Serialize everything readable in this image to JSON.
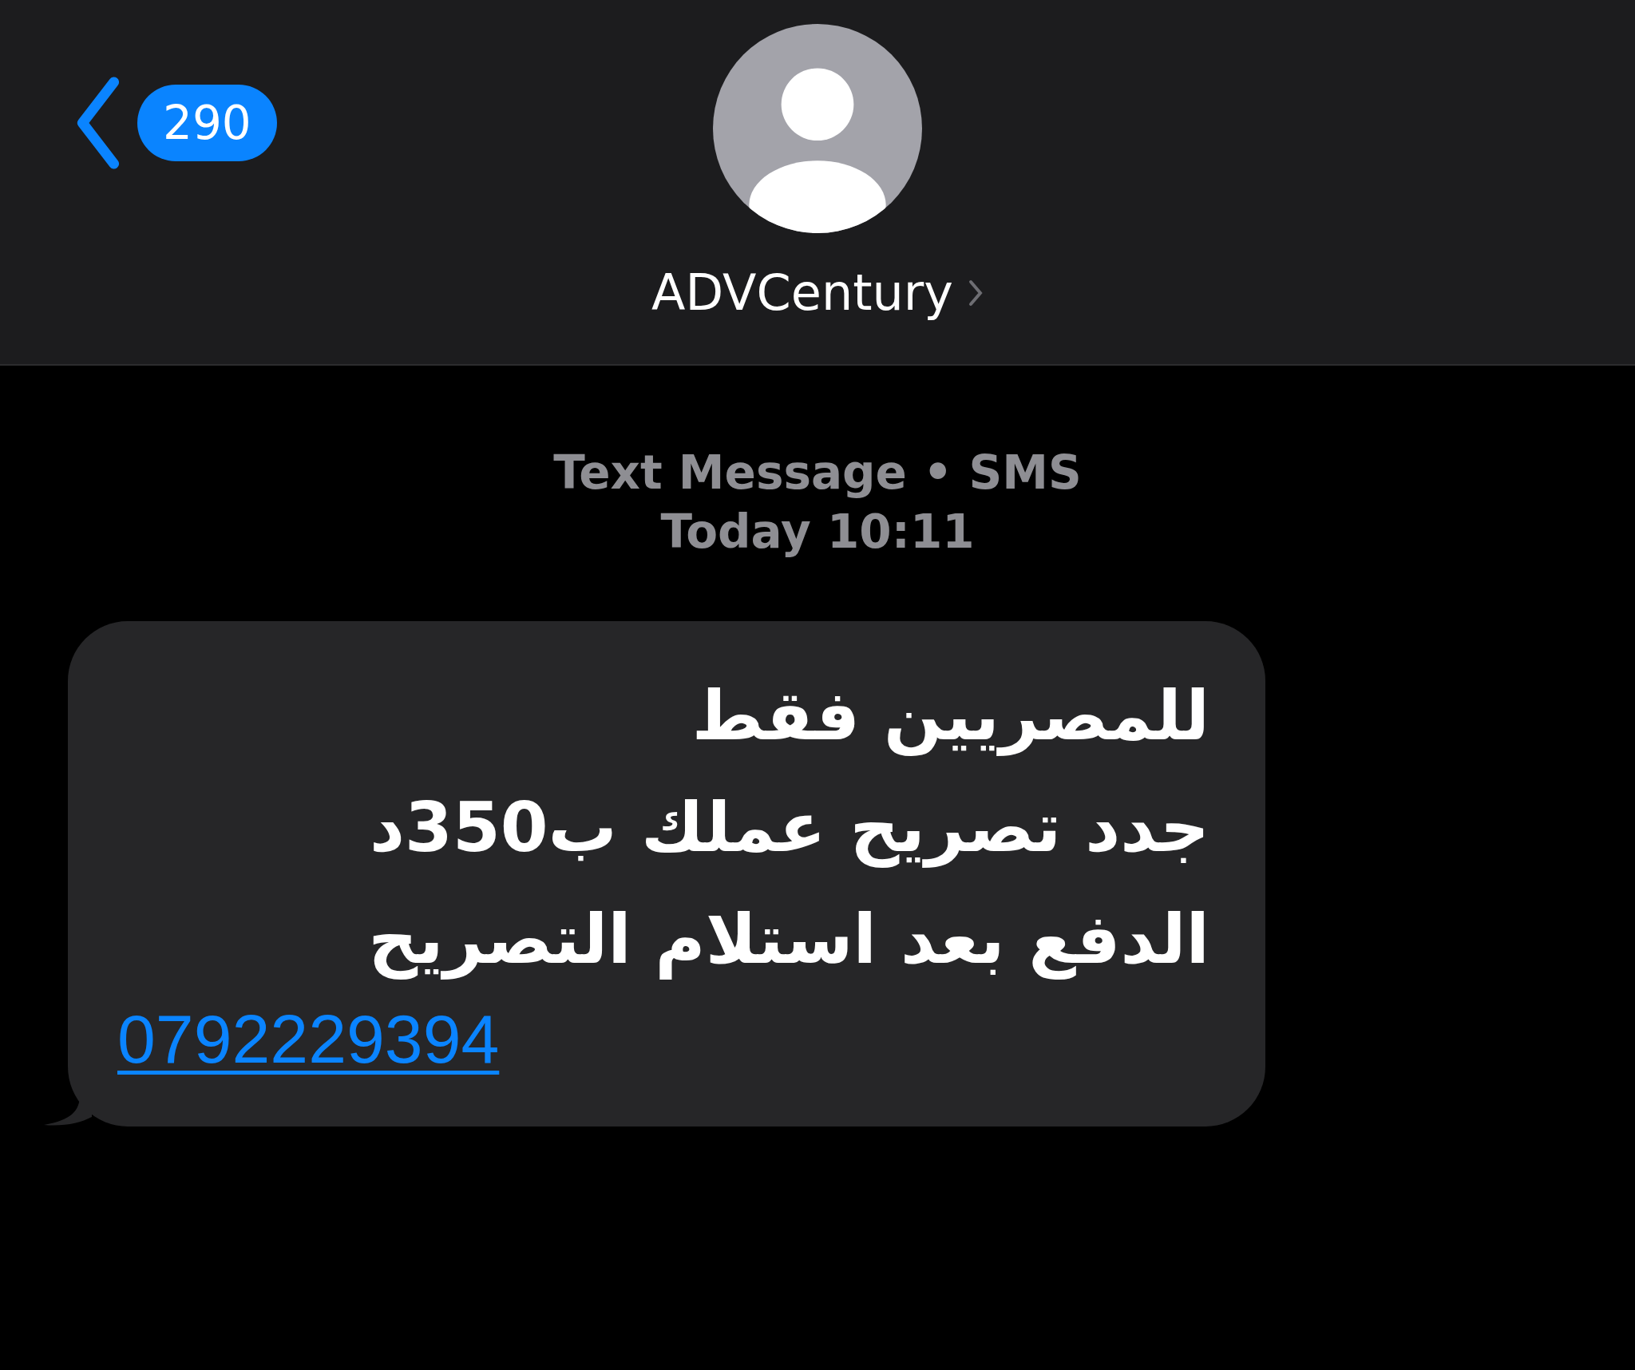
{
  "header": {
    "back_count": "290",
    "contact_name": "ADVCentury"
  },
  "thread_info": {
    "service": "Text Message • SMS",
    "timestamp": "Today 10:11"
  },
  "messages": [
    {
      "text": "للمصريين فقط\nجدد تصريح عملك ب350د\nالدفع بعد استلام التصريح",
      "link": "0792229394"
    }
  ]
}
